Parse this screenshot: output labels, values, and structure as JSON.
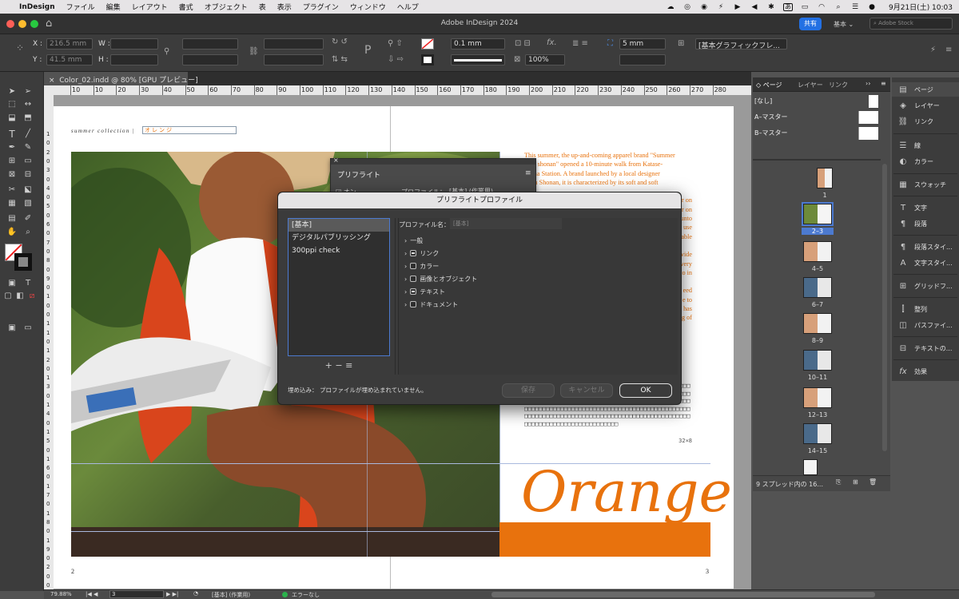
{
  "menubar": {
    "app": "InDesign",
    "items": [
      "ファイル",
      "編集",
      "レイアウト",
      "書式",
      "オブジェクト",
      "表",
      "表示",
      "プラグイン",
      "ウィンドウ",
      "ヘルプ"
    ],
    "ime": "あ",
    "clock": "9月21日(土) 10:03"
  },
  "window": {
    "title": "Adobe InDesign 2024",
    "share": "共有",
    "workspace": "基本 ⌄",
    "stock_placeholder": "Adobe Stock"
  },
  "control": {
    "x_label": "X :",
    "y_label": "Y :",
    "w_label": "W :",
    "h_label": "H :",
    "x_value": "216.5 mm",
    "y_value": "41.5 mm",
    "stroke_weight": "0.1 mm",
    "opacity": "100%",
    "gap": "5 mm",
    "object_style": "[基本グラフィックフレ..."
  },
  "document": {
    "tab": "Color_02.indd @ 80% [GPU プレビュー]",
    "header_text": "summer collection  |",
    "header_field": "オレンジ",
    "page_left": "2",
    "page_right": "3",
    "big_word": "Orange",
    "body_lines": [
      "This summer, the up-and-coming apparel brand \"Summer",
      "eeze shonan\" opened a 10-minute walk from Katase-",
      "shima Station. A brand launched by a local designer",
      "ng in Shonan, it is characterized by its soft and soft",
      "",
      "r on",
      "r on",
      "unto",
      "use",
      "able",
      "",
      "vide",
      "very",
      "o in",
      "",
      "eed",
      "e to",
      "has",
      "g of"
    ],
    "grid_count": "32×8"
  },
  "ruler": {
    "h": [
      "10",
      "10",
      "20",
      "30",
      "40",
      "50",
      "60",
      "70",
      "80",
      "90",
      "100",
      "110",
      "120",
      "130",
      "140",
      "150",
      "160",
      "170",
      "180",
      "190",
      "200",
      "210",
      "220",
      "230",
      "240",
      "250",
      "260",
      "270",
      "280"
    ],
    "v": [
      "1",
      "0",
      "2",
      "0",
      "3",
      "0",
      "4",
      "0",
      "5",
      "0",
      "6",
      "0",
      "7",
      "0",
      "8",
      "0",
      "9",
      "0",
      "1",
      "0",
      "0",
      "1",
      "1",
      "0",
      "1",
      "2",
      "0",
      "1",
      "3",
      "0",
      "1",
      "4",
      "0",
      "1",
      "5",
      "0",
      "1",
      "6",
      "0",
      "1",
      "7",
      "0",
      "1",
      "8",
      "0",
      "1",
      "9",
      "0",
      "2",
      "0",
      "0"
    ]
  },
  "preflight_panel": {
    "title": "プリフライト",
    "on_label": "オン",
    "profile_label": "プロファイル：",
    "profile_value": "[基本] (作業用)"
  },
  "dialog": {
    "title": "プリフライトプロファイル",
    "profiles": [
      "[基本]",
      "デジタルパブリッシング",
      "300ppi check"
    ],
    "profile_name_label": "プロファイル名：",
    "profile_name_value": "[基本]",
    "categories": [
      "一般",
      "リンク",
      "カラー",
      "画像とオブジェクト",
      "テキスト",
      "ドキュメント"
    ],
    "list_tools": "+  −  ≡",
    "embed_label": "埋め込み：",
    "embed_status": "プロファイルが埋め込まれていません。",
    "save": "保存",
    "cancel": "キャンセル",
    "ok": "OK"
  },
  "pages_panel": {
    "tabs": [
      "ページ",
      "レイヤー",
      "リンク"
    ],
    "masters": [
      "[なし]",
      "A–マスター",
      "B–マスター"
    ],
    "thumbs": [
      "1",
      "2–3",
      "4–5",
      "6–7",
      "8–9",
      "10–11",
      "12–13",
      "14–15"
    ],
    "footer": "9 スプレッド内の 16..."
  },
  "icon_panel": {
    "items": [
      "ページ",
      "レイヤー",
      "リンク",
      "線",
      "カラー",
      "スウォッチ",
      "文字",
      "段落",
      "段落スタイ...",
      "文字スタイ...",
      "グリッドフ...",
      "整列",
      "パスファイ...",
      "テキストの...",
      "効果"
    ]
  },
  "status": {
    "zoom": "79.88%",
    "page": "3",
    "style": "[基本] (作業用)",
    "errors": "エラーなし"
  },
  "colors": {
    "accent": "#e8720d",
    "selection": "#4c7ad0",
    "ok_green": "#2bb24c"
  }
}
